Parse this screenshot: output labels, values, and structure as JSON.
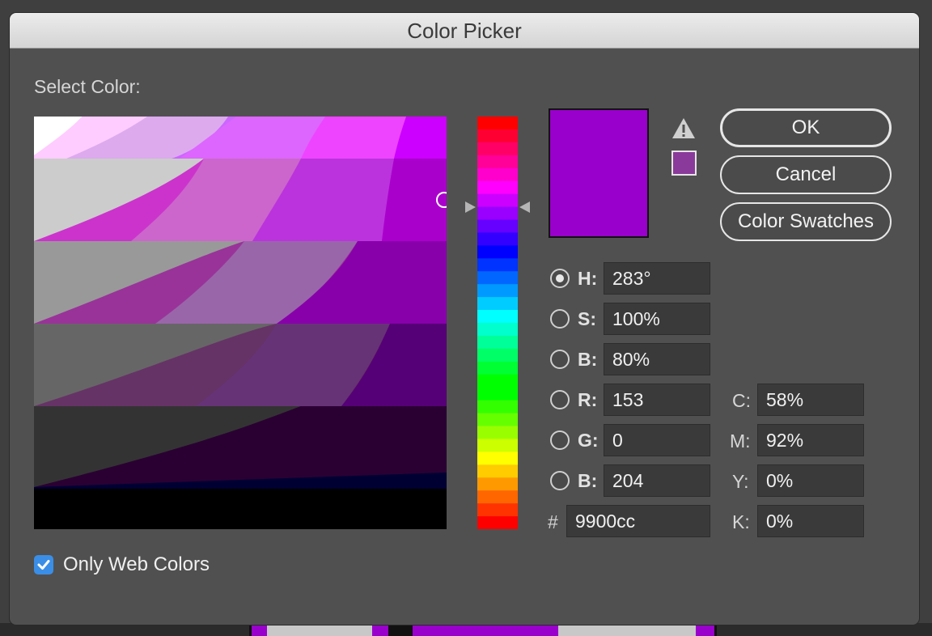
{
  "window": {
    "title": "Color Picker"
  },
  "picker": {
    "select_label": "Select Color:",
    "current_color": "#9900cc",
    "websafe_color": "#8a3a9a",
    "warning_icon": "warning-triangle-icon",
    "hue_spectrum": [
      "#ff0000",
      "#ff0033",
      "#ff0066",
      "#ff0099",
      "#ff00cc",
      "#ff00ff",
      "#cc00ff",
      "#9900ff",
      "#6600ff",
      "#3300ff",
      "#0000ff",
      "#0033ff",
      "#0066ff",
      "#0099ff",
      "#00ccff",
      "#00ffff",
      "#00ffcc",
      "#00ff99",
      "#00ff66",
      "#00ff33",
      "#00ff00",
      "#00ff00",
      "#33ff00",
      "#66ff00",
      "#99ff00",
      "#ccff00",
      "#ffff00",
      "#ffcc00",
      "#ff9900",
      "#ff6600",
      "#ff3300",
      "#ff0000"
    ]
  },
  "buttons": {
    "ok": "OK",
    "cancel": "Cancel",
    "swatches": "Color Swatches"
  },
  "hsb": {
    "h": {
      "label": "H:",
      "value": "283°",
      "selected": true
    },
    "s": {
      "label": "S:",
      "value": "100%"
    },
    "b": {
      "label": "B:",
      "value": "80%"
    }
  },
  "rgb": {
    "r": {
      "label": "R:",
      "value": "153"
    },
    "g": {
      "label": "G:",
      "value": "0"
    },
    "b": {
      "label": "B:",
      "value": "204"
    }
  },
  "hex": {
    "label": "#",
    "value": "9900cc"
  },
  "cmyk": {
    "c": {
      "label": "C:",
      "value": "58%"
    },
    "m": {
      "label": "M:",
      "value": "92%"
    },
    "y": {
      "label": "Y:",
      "value": "0%"
    },
    "k": {
      "label": "K:",
      "value": "0%"
    }
  },
  "web_only": {
    "label": "Only Web Colors",
    "checked": true
  }
}
